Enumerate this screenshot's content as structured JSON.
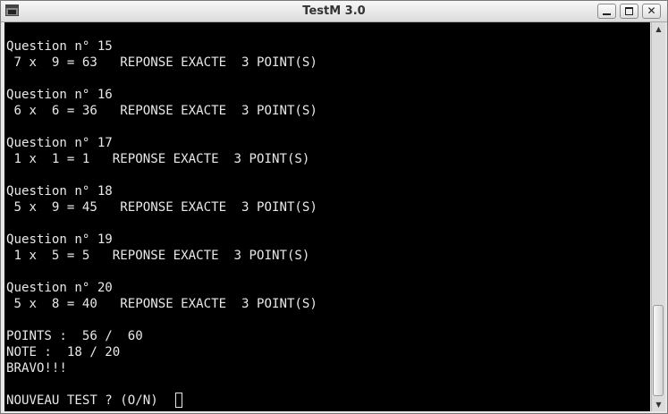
{
  "window": {
    "title": "TestM 3.0"
  },
  "terminal": {
    "lines": [
      "",
      "Question n° 15",
      " 7 x  9 = 63   REPONSE EXACTE  3 POINT(S)",
      "",
      "Question n° 16",
      " 6 x  6 = 36   REPONSE EXACTE  3 POINT(S)",
      "",
      "Question n° 17",
      " 1 x  1 = 1   REPONSE EXACTE  3 POINT(S)",
      "",
      "Question n° 18",
      " 5 x  9 = 45   REPONSE EXACTE  3 POINT(S)",
      "",
      "Question n° 19",
      " 1 x  5 = 5   REPONSE EXACTE  3 POINT(S)",
      "",
      "Question n° 20",
      " 5 x  8 = 40   REPONSE EXACTE  3 POINT(S)",
      "",
      "POINTS :  56 /  60",
      "NOTE :  18 / 20",
      "BRAVO!!!",
      "",
      "NOUVEAU TEST ? (O/N) "
    ]
  },
  "icons": {
    "app": "terminal-icon",
    "minimize": "minimize-icon",
    "maximize": "maximize-icon",
    "close": "close-icon",
    "scroll_up": "scroll-up-arrow-icon",
    "scroll_down": "scroll-down-arrow-icon"
  },
  "colors": {
    "terminal_background": "#000000",
    "terminal_text": "#e8e8e8"
  }
}
